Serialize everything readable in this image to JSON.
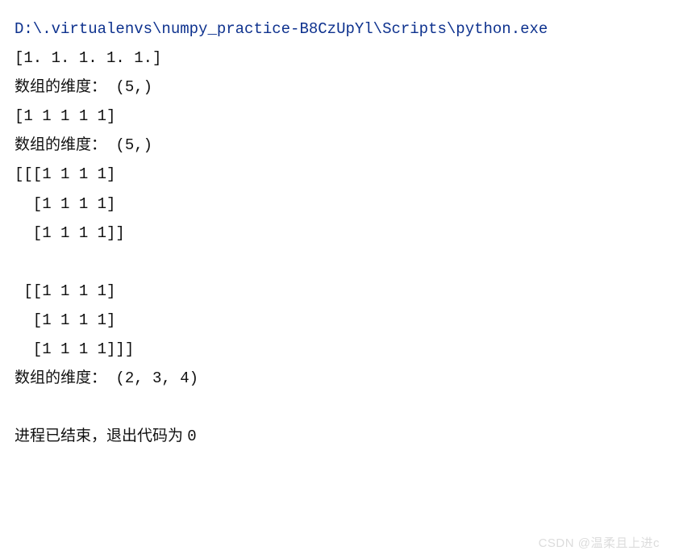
{
  "header": {
    "path": "D:\\.virtualenvs\\numpy_practice-B8CzUpYl\\Scripts\\python.exe"
  },
  "lines": {
    "arr1": "[1. 1. 1. 1. 1.]",
    "dim1_label": "数组的维度：",
    "dim1_value": " (5,)",
    "arr2": "[1 1 1 1 1]",
    "dim2_label": "数组的维度：",
    "dim2_value": " (5,)",
    "arr3_l1": "[[[1 1 1 1]",
    "arr3_l2": "  [1 1 1 1]",
    "arr3_l3": "  [1 1 1 1]]",
    "arr3_l4": " [[1 1 1 1]",
    "arr3_l5": "  [1 1 1 1]",
    "arr3_l6": "  [1 1 1 1]]]",
    "dim3_label": "数组的维度：",
    "dim3_value": " (2, 3, 4)",
    "exit_prefix": "进程已结束，退出代码为 ",
    "exit_code": "0"
  },
  "watermark": "CSDN @温柔且上进c"
}
